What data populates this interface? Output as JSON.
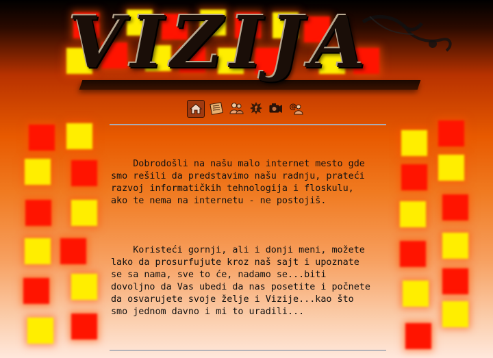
{
  "site": {
    "logo_text": "VIZIJA"
  },
  "nav": {
    "items": [
      {
        "icon": "home-icon",
        "label": "home"
      },
      {
        "icon": "news-icon",
        "label": "news"
      },
      {
        "icon": "users-icon",
        "label": "users"
      },
      {
        "icon": "facebook-icon",
        "label": "facebook"
      },
      {
        "icon": "camera-icon",
        "label": "camera"
      },
      {
        "icon": "contact-icon",
        "label": "contact"
      }
    ]
  },
  "content": {
    "paragraph_1": "    Dobrodošli na našu malo internet mesto gde\nsmo rešili da predstavimo našu radnju, prateći\nrazvoj informatičkih tehnologija i floskulu,\nako te nema na internetu - ne postojiš.",
    "paragraph_2": "    Koristeći gornji, ali i donji meni, možete\nlako da prosurfujute kroz naš sajt i upoznate\nse sa nama, sve to će, nadamo se...biti\ndovoljno da Vas ubedi da nas posetite i počnete\nda osvarujete svoje želje i Vizije...kao što\nsmo jednom davno i mi to uradili..."
  },
  "colors": {
    "red_square": "#ff1400",
    "yellow_square": "#ffee00",
    "text": "#111111"
  }
}
